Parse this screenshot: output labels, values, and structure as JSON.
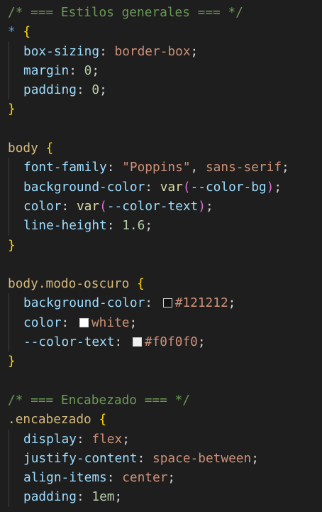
{
  "editor": {
    "lines": [
      {
        "comment": "/* === Estilos generales === */"
      },
      {
        "selector": "*",
        "brace": "{"
      },
      {
        "prop": "box-sizing",
        "value": "border-box"
      },
      {
        "prop": "margin",
        "value": "0"
      },
      {
        "prop": "padding",
        "value": "0"
      },
      {
        "brace": "}"
      },
      {},
      {
        "selector": "body",
        "brace": "{"
      },
      {
        "prop": "font-family",
        "value_string": "\"Poppins\"",
        "value_rest": "sans-serif"
      },
      {
        "prop": "background-color",
        "func": "var",
        "arg": "--color-bg"
      },
      {
        "prop": "color",
        "func": "var",
        "arg": "--color-text"
      },
      {
        "prop": "line-height",
        "value": "1.6"
      },
      {
        "brace": "}"
      },
      {},
      {
        "selector": "body.modo-oscuro",
        "brace": "{"
      },
      {
        "prop": "background-color",
        "value": "#121212",
        "swatch": "#121212"
      },
      {
        "prop": "color",
        "value": "white",
        "swatch": "#ffffff"
      },
      {
        "prop": "--color-text",
        "value": "#f0f0f0",
        "swatch": "#f0f0f0"
      },
      {
        "brace": "}"
      },
      {},
      {
        "comment": "/* === Encabezado === */"
      },
      {
        "selector": ".encabezado",
        "brace": "{"
      },
      {
        "prop": "display",
        "value": "flex"
      },
      {
        "prop": "justify-content",
        "value": "space-between"
      },
      {
        "prop": "align-items",
        "value": "center"
      },
      {
        "prop": "padding",
        "value": "1em"
      }
    ]
  },
  "colors": {
    "background": "#1e1e1e",
    "comment": "#6a9955",
    "selector": "#d7ba7d",
    "universal": "#569cd6",
    "property": "#9cdcfe",
    "value": "#ce9178",
    "number": "#b5cea8",
    "function": "#dcdcaa",
    "brace": "#ffd700",
    "paren": "#da70d6"
  }
}
